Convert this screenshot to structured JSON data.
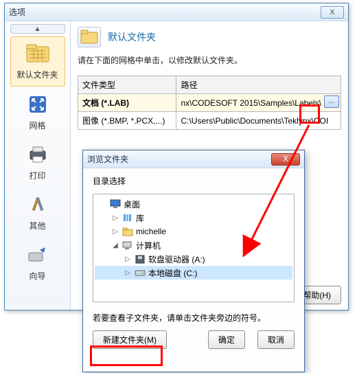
{
  "window": {
    "title": "选项",
    "close": "X"
  },
  "sidebar": {
    "up": "▲",
    "items": [
      {
        "label": "默认文件夹"
      },
      {
        "label": "网格"
      },
      {
        "label": "打印"
      },
      {
        "label": "其他"
      },
      {
        "label": "向导"
      }
    ]
  },
  "main": {
    "header": "默认文件夹",
    "instruction": "请在下面的网格中单击，以修改默认文件夹。",
    "cols": {
      "type": "文件类型",
      "path": "路径"
    },
    "rows": [
      {
        "type": "文档 (*.LAB)",
        "path": "nx\\CODESOFT 2015\\Samples\\Labels\\",
        "selected": true,
        "browse": true
      },
      {
        "type": "图像 (*.BMP, *.PCX,...)",
        "path": "C:\\Users\\Public\\Documents\\Teklynx\\COI"
      }
    ],
    "browse_btn": "...",
    "help": "帮助(H)"
  },
  "dialog": {
    "title": "浏览文件夹",
    "close": "X",
    "subtitle": "目录选择",
    "tree": [
      {
        "exp": "",
        "icon": "desktop",
        "label": "桌面",
        "indent": 0
      },
      {
        "exp": "▷",
        "icon": "library",
        "label": "库",
        "indent": 1
      },
      {
        "exp": "▷",
        "icon": "folder",
        "label": "michelle",
        "indent": 1
      },
      {
        "exp": "◢",
        "icon": "computer",
        "label": "计算机",
        "indent": 1
      },
      {
        "exp": "▷",
        "icon": "floppy",
        "label": "软盘驱动器 (A:)",
        "indent": 2
      },
      {
        "exp": "▷",
        "icon": "drive",
        "label": "本地磁盘 (C:)",
        "indent": 2,
        "selected": true
      }
    ],
    "hint": "若要查看子文件夹，请单击文件夹旁边的符号。",
    "new_folder": "新建文件夹(M)",
    "ok": "确定",
    "cancel": "取消"
  }
}
